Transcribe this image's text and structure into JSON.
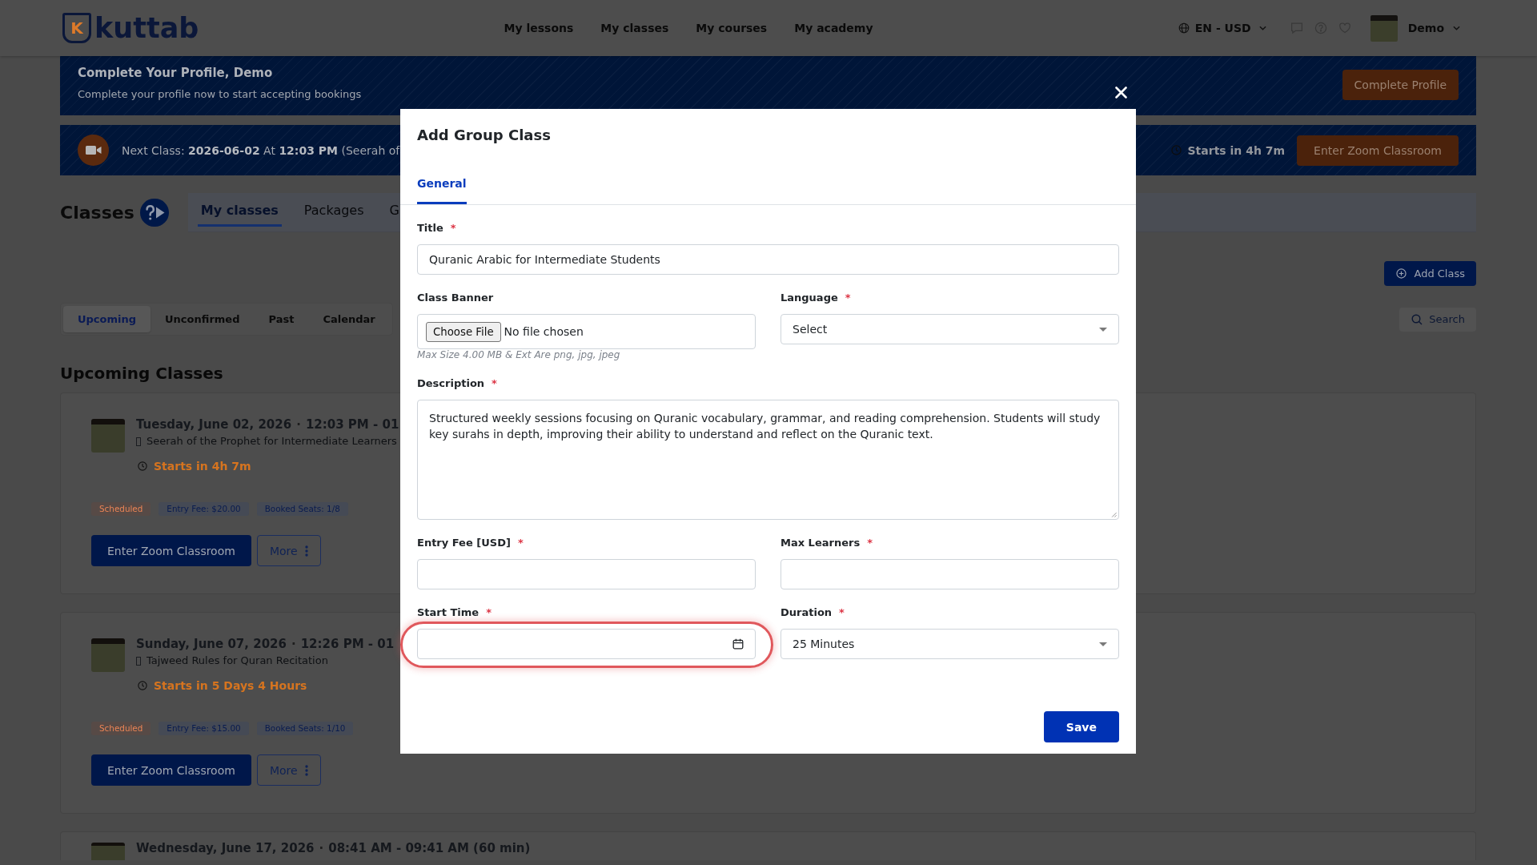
{
  "header": {
    "logo": {
      "mark": "K",
      "name": "kuttab"
    },
    "nav": [
      "My lessons",
      "My classes",
      "My courses",
      "My academy"
    ],
    "locale": "EN - USD",
    "user": "Demo"
  },
  "profile_banner": {
    "title": "Complete Your Profile, Demo",
    "text": "Complete your profile now to start accepting bookings",
    "button": "Complete Profile"
  },
  "next_class_banner": {
    "text": "Next Class: **2026-06-02** At **12:03 PM** (Seerah of",
    "countdown": "Starts in 4h 7m",
    "button": "Enter Zoom Classroom"
  },
  "classes_page": {
    "title": "Classes",
    "tabs": [
      {
        "label": "My classes",
        "selected": true
      },
      {
        "label": "Packages",
        "selected": false
      },
      {
        "label": "G",
        "selected": false
      }
    ],
    "add_button": "Add Class",
    "filters": [
      {
        "label": "Upcoming",
        "selected": true
      },
      {
        "label": "Unconfirmed",
        "selected": false
      },
      {
        "label": "Past",
        "selected": false
      },
      {
        "label": "Calendar",
        "selected": false
      }
    ],
    "search_button": "Search",
    "section_title": "Upcoming Classes"
  },
  "classes": [
    {
      "date": "Tuesday, June 02, 2026",
      "separator": "·",
      "time": "12:03 PM - 01",
      "course": "Seerah of the Prophet for Intermediate Learners",
      "countdown": "Starts in 4h 7m",
      "badges": [
        {
          "label": "Scheduled",
          "kind": "status"
        },
        {
          "label": "Entry Fee: $20.00",
          "kind": "info"
        },
        {
          "label": "Booked Seats: 1/8",
          "kind": "info"
        }
      ],
      "buttons": [
        {
          "label": "Enter Zoom Classroom",
          "kind": "primary"
        },
        {
          "label": "More",
          "kind": "menu"
        }
      ]
    },
    {
      "date": "Sunday, June 07, 2026",
      "separator": "·",
      "time": "12:26 PM - 01",
      "course": "Tajweed Rules for Quran Recitation",
      "countdown": "Starts in 5 Days 4 Hours",
      "badges": [
        {
          "label": "Scheduled",
          "kind": "status"
        },
        {
          "label": "Entry Fee: $15.00",
          "kind": "info"
        },
        {
          "label": "Booked Seats: 1/10",
          "kind": "info"
        }
      ],
      "buttons": [
        {
          "label": "Enter Zoom Classroom",
          "kind": "primary"
        },
        {
          "label": "More",
          "kind": "menu"
        }
      ]
    },
    {
      "date": "Wednesday, June 17, 2026",
      "separator": "·",
      "time": "08:41 AM - 09:41 AM (60 min)"
    }
  ],
  "modal": {
    "title": "Add Group Class",
    "tabs": [
      {
        "label": "General",
        "selected": true
      }
    ],
    "rows": [
      [
        {
          "kind": "text",
          "label": "Title",
          "required_mark": "*",
          "value": "Quranic Arabic for Intermediate Students",
          "highlighted": false
        }
      ],
      [
        {
          "kind": "file",
          "label": "Class Banner",
          "button": "Choose File",
          "value": "No file chosen",
          "hint": "Max Size 4.00 MB & Ext Are png, jpg, jpeg",
          "highlighted": false
        },
        {
          "kind": "select",
          "label": "Language",
          "required_mark": "*",
          "value": "Select",
          "highlighted": false
        }
      ],
      [
        {
          "kind": "textarea",
          "label": "Description",
          "required_mark": "*",
          "value": "Structured weekly sessions focusing on Quranic vocabulary, grammar, and reading comprehension. Students will study key surahs in depth, improving their ability to understand and reflect on the Quranic text.",
          "highlighted": false
        }
      ],
      [
        {
          "kind": "text",
          "label": "Entry Fee [USD]",
          "required_mark": "*",
          "highlighted": false
        },
        {
          "kind": "text",
          "label": "Max Learners",
          "required_mark": "*",
          "highlighted": false
        }
      ],
      [
        {
          "kind": "date",
          "label": "Start Time",
          "required_mark": "*",
          "highlighted": true
        },
        {
          "kind": "select",
          "label": "Duration",
          "required_mark": "*",
          "value": "25 Minutes",
          "highlighted": false
        }
      ]
    ],
    "save_button": "Save"
  }
}
